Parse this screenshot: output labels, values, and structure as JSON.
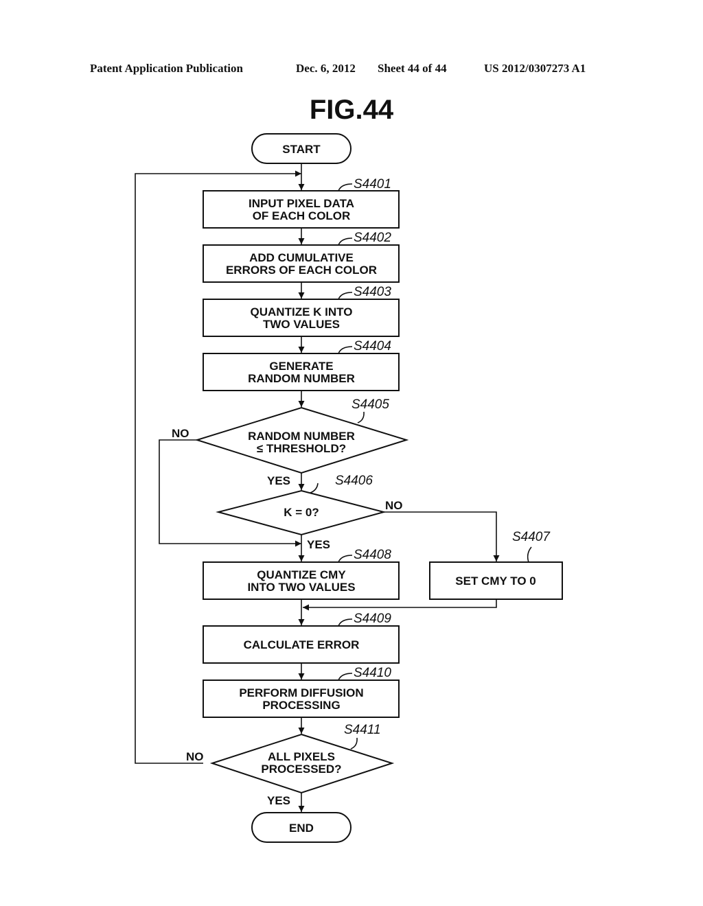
{
  "header": {
    "publication": "Patent Application Publication",
    "date": "Dec. 6, 2012",
    "sheet": "Sheet 44 of 44",
    "number": "US 2012/0307273 A1"
  },
  "figure_title": "FIG.44",
  "flowchart": {
    "start": "START",
    "end": "END",
    "steps": {
      "s4401": {
        "id": "S4401",
        "lines": [
          "INPUT PIXEL DATA",
          "OF EACH COLOR"
        ]
      },
      "s4402": {
        "id": "S4402",
        "lines": [
          "ADD CUMULATIVE",
          "ERRORS OF EACH COLOR"
        ]
      },
      "s4403": {
        "id": "S4403",
        "lines": [
          "QUANTIZE K INTO",
          "TWO VALUES"
        ]
      },
      "s4404": {
        "id": "S4404",
        "lines": [
          "GENERATE",
          "RANDOM NUMBER"
        ]
      },
      "s4405": {
        "id": "S4405",
        "lines": [
          "RANDOM NUMBER",
          "≤ THRESHOLD?"
        ]
      },
      "s4406": {
        "id": "S4406",
        "lines": [
          "K = 0?"
        ]
      },
      "s4407": {
        "id": "S4407",
        "lines": [
          "SET CMY TO 0"
        ]
      },
      "s4408": {
        "id": "S4408",
        "lines": [
          "QUANTIZE CMY",
          "INTO TWO VALUES"
        ]
      },
      "s4409": {
        "id": "S4409",
        "lines": [
          "CALCULATE ERROR"
        ]
      },
      "s4410": {
        "id": "S4410",
        "lines": [
          "PERFORM DIFFUSION",
          "PROCESSING"
        ]
      },
      "s4411": {
        "id": "S4411",
        "lines": [
          "ALL PIXELS",
          "PROCESSED?"
        ]
      }
    },
    "branch_labels": {
      "s4405_no": "NO",
      "s4405_yes": "YES",
      "s4406_no": "NO",
      "s4406_yes": "YES",
      "s4411_no": "NO",
      "s4411_yes": "YES"
    }
  }
}
